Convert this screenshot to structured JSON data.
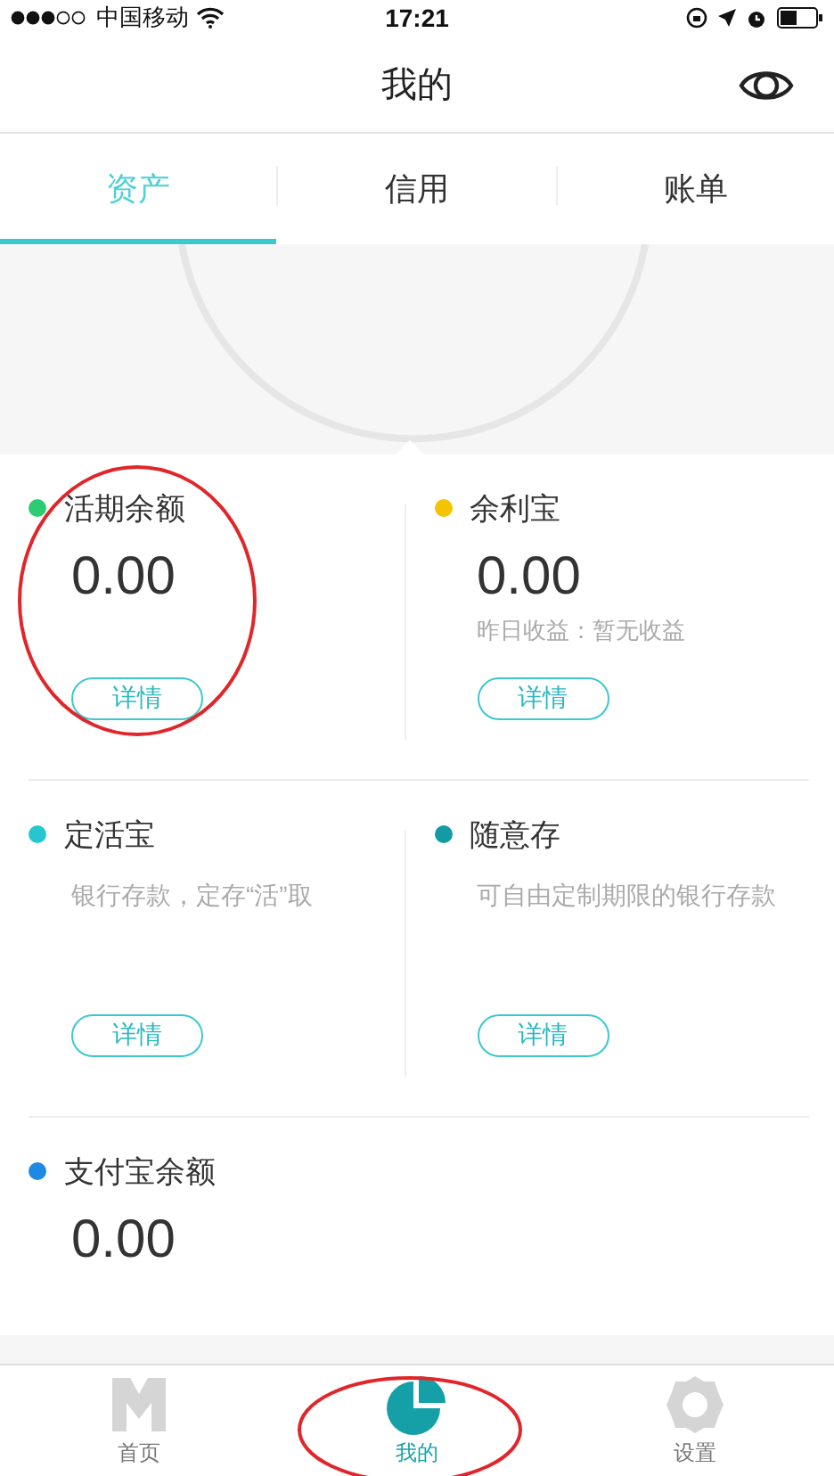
{
  "status_bar": {
    "carrier": "中国移动",
    "time": "17:21"
  },
  "header": {
    "title": "我的"
  },
  "tabs": [
    {
      "label": "资产",
      "selected": true
    },
    {
      "label": "信用",
      "selected": false
    },
    {
      "label": "账单",
      "selected": false
    }
  ],
  "accounts": [
    {
      "kind": "balance",
      "name": "活期余额",
      "color": "#2ecc71",
      "amount": "0.00",
      "button": "详情",
      "circled": true
    },
    {
      "kind": "balance",
      "name": "余利宝",
      "color": "#f5c400",
      "amount": "0.00",
      "note": "昨日收益：暂无收益",
      "button": "详情",
      "circled": false
    },
    {
      "kind": "product",
      "name": "定活宝",
      "color": "#26c6d0",
      "note": "银行存款，定存“活”取",
      "button": "详情",
      "circled": false
    },
    {
      "kind": "product",
      "name": "随意存",
      "color": "#139aa5",
      "note": "可自由定制期限的银行存款",
      "button": "详情",
      "circled": false
    },
    {
      "kind": "wide",
      "name": "支付宝余额",
      "color": "#1e88e5",
      "amount": "0.00",
      "circled": false
    }
  ],
  "nav": [
    {
      "kind": "home",
      "label": "首页",
      "selected": false,
      "circled": false
    },
    {
      "kind": "mine",
      "label": "我的",
      "selected": true,
      "circled": true
    },
    {
      "kind": "settings",
      "label": "设置",
      "selected": false,
      "circled": false
    }
  ]
}
